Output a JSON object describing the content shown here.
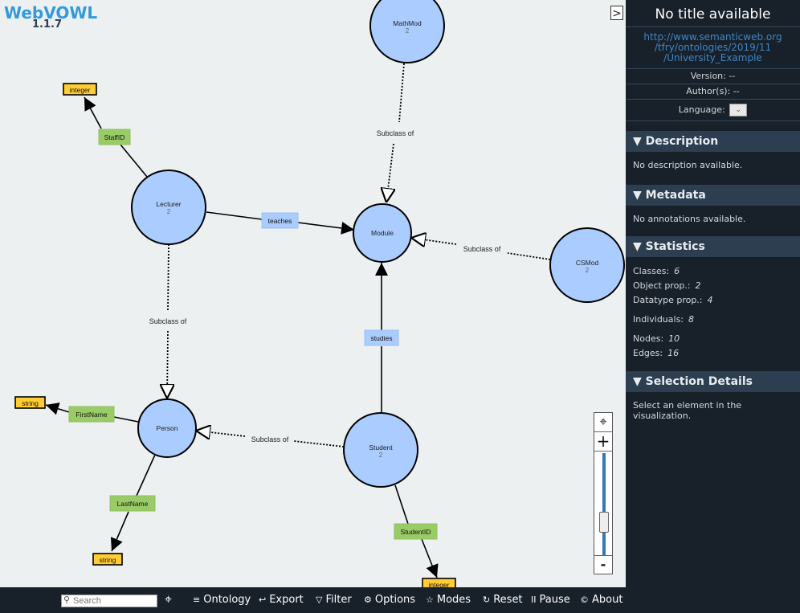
{
  "app": {
    "name": "WebVOWL",
    "version": "1.1.7",
    "sidebar_toggle": ">"
  },
  "graph": {
    "nodes": [
      {
        "id": "mathmod",
        "label": "MathMod",
        "count": "2",
        "type": "class"
      },
      {
        "id": "lecturer",
        "label": "Lecturer",
        "count": "2",
        "type": "class"
      },
      {
        "id": "module",
        "label": "Module",
        "count": "",
        "type": "class"
      },
      {
        "id": "csmod",
        "label": "CSMod",
        "count": "2",
        "type": "class"
      },
      {
        "id": "person",
        "label": "Person",
        "count": "",
        "type": "class"
      },
      {
        "id": "student",
        "label": "Student",
        "count": "2",
        "type": "class"
      }
    ],
    "datatypes": [
      {
        "id": "dt-integer-1",
        "label": "integer"
      },
      {
        "id": "dt-string-1",
        "label": "string"
      },
      {
        "id": "dt-string-2",
        "label": "string"
      },
      {
        "id": "dt-integer-2",
        "label": "integer"
      }
    ],
    "properties": [
      {
        "id": "staffid",
        "label": "StaffID",
        "kind": "datatype",
        "from": "lecturer",
        "to": "dt-integer-1"
      },
      {
        "id": "teaches",
        "label": "teaches",
        "kind": "object",
        "from": "lecturer",
        "to": "module"
      },
      {
        "id": "studies",
        "label": "studies",
        "kind": "object",
        "from": "student",
        "to": "module"
      },
      {
        "id": "firstname",
        "label": "FirstName",
        "kind": "datatype",
        "from": "person",
        "to": "dt-string-1"
      },
      {
        "id": "lastname",
        "label": "LastName",
        "kind": "datatype",
        "from": "person",
        "to": "dt-string-2"
      },
      {
        "id": "studentid",
        "label": "StudentID",
        "kind": "datatype",
        "from": "student",
        "to": "dt-integer-2"
      },
      {
        "id": "sub-mathmod",
        "label": "Subclass of",
        "kind": "subclass",
        "from": "mathmod",
        "to": "module"
      },
      {
        "id": "sub-csmod",
        "label": "Subclass of",
        "kind": "subclass",
        "from": "csmod",
        "to": "module"
      },
      {
        "id": "sub-lecturer",
        "label": "Subclass of",
        "kind": "subclass",
        "from": "lecturer",
        "to": "person"
      },
      {
        "id": "sub-student",
        "label": "Subclass of",
        "kind": "subclass",
        "from": "student",
        "to": "person"
      }
    ],
    "colors": {
      "class": "#aaccff",
      "datatype": "#ffcc33",
      "datatype_property": "#99cc66",
      "object_property": "#aaccff",
      "background": "#ecf0f1"
    }
  },
  "sidebar": {
    "title": "No title available",
    "iri": [
      "http://www.semanticweb.org",
      "/tfry/ontologies/2019/11",
      "/University_Example"
    ],
    "version": "Version: --",
    "authors": "Author(s): --",
    "language_label": "Language:",
    "language_value": "",
    "sections": {
      "description": {
        "title": "▼ Description",
        "text": "No description available."
      },
      "metadata": {
        "title": "▼ Metadata",
        "text": "No annotations available."
      },
      "statistics": {
        "title": "▼ Statistics"
      },
      "selection": {
        "title": "▼ Selection Details",
        "text": "Select an element in the visualization."
      }
    },
    "statistics": {
      "classes": {
        "label": "Classes:",
        "value": "6"
      },
      "object_props": {
        "label": "Object prop.:",
        "value": "2"
      },
      "datatype_props": {
        "label": "Datatype prop.:",
        "value": "4"
      },
      "individuals": {
        "label": "Individuals:",
        "value": "8"
      },
      "nodes": {
        "label": "Nodes:",
        "value": "10"
      },
      "edges": {
        "label": "Edges:",
        "value": "16"
      }
    }
  },
  "toolbar": {
    "search_placeholder": "Search",
    "locate_icon": "⌖",
    "items": [
      {
        "id": "ontology",
        "icon": "≡",
        "label": "Ontology"
      },
      {
        "id": "export",
        "icon": "↩",
        "label": "Export"
      },
      {
        "id": "filter",
        "icon": "▽",
        "label": "Filter"
      },
      {
        "id": "options",
        "icon": "⚙",
        "label": "Options"
      },
      {
        "id": "modes",
        "icon": "☆",
        "label": "Modes"
      },
      {
        "id": "reset",
        "icon": "↻",
        "label": "Reset"
      },
      {
        "id": "pause",
        "icon": "II",
        "label": "Pause"
      },
      {
        "id": "about",
        "icon": "©",
        "label": "About"
      }
    ]
  },
  "zoom_control": {
    "center_icon": "⌖",
    "zoom_in": "+",
    "zoom_out": "-",
    "level_fraction": 0.3
  }
}
